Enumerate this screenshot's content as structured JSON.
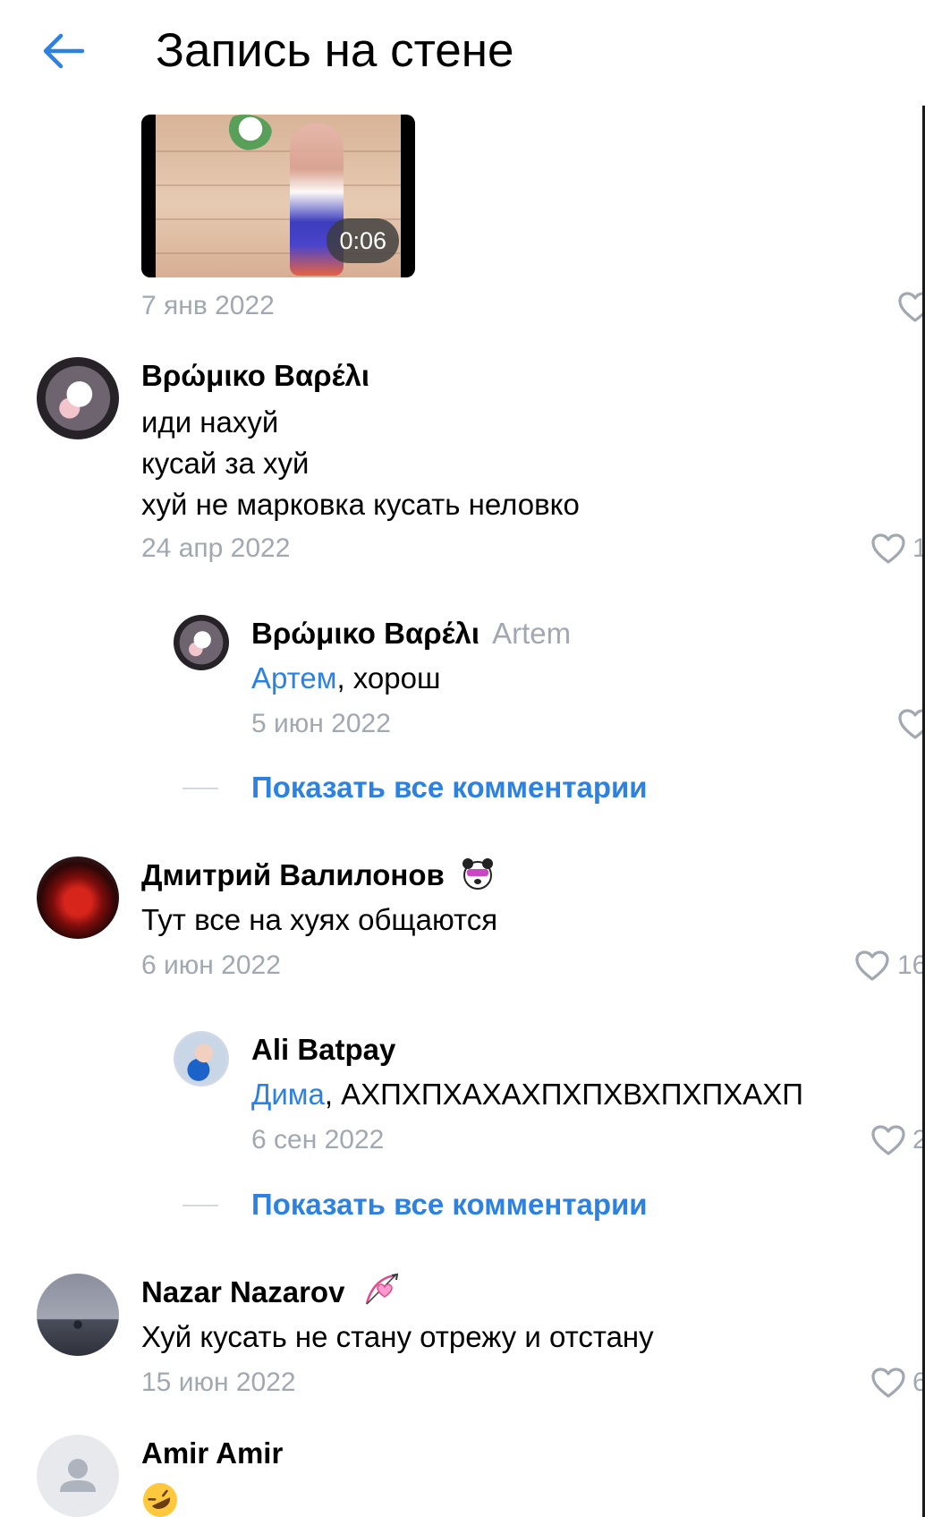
{
  "header": {
    "title": "Запись на стене"
  },
  "post": {
    "video_duration": "0:06",
    "date": "7 янв 2022"
  },
  "comments": [
    {
      "author": "Βρώμικο Βαρέλι",
      "lines": [
        "иди нахуй",
        "кусай за хуй",
        "хуй не марковка кусать неловко"
      ],
      "date": "24 апр 2022",
      "likes": "1"
    },
    {
      "author": "Βρώμικο Βαρέλι",
      "reply_to": "Artem",
      "mention": "Артем",
      "text": ", хорош",
      "date": "5 июн 2022"
    },
    {
      "author": "Дмитрий Валилонов",
      "text": "Тут все на хуях общаются",
      "date": "6 июн 2022",
      "likes": "16"
    },
    {
      "author": "Ali Batpay",
      "mention": "Дима",
      "text": ", АХПХПХАХАХПХПХВХПХПХАХП",
      "date": "6 сен 2022",
      "likes": "2"
    },
    {
      "author": "Nazar Nazarov",
      "text": "Хуй кусать не стану отрежу и отстану",
      "date": "15 июн 2022",
      "likes": "6"
    },
    {
      "author": "Amir Amir"
    }
  ],
  "show_all_label": "Показать все комментарии",
  "colors": {
    "accent": "#2d81e0",
    "secondary_text": "#a2a8b1",
    "text": "#000000",
    "background": "#ffffff"
  },
  "icons": {
    "back": "arrow-left-icon",
    "like": "heart-outline-icon",
    "badge_1": "panda-sticker-badge-icon",
    "badge_2": "bow-heart-badge-icon",
    "emoji": "rofl-emoji-icon"
  }
}
